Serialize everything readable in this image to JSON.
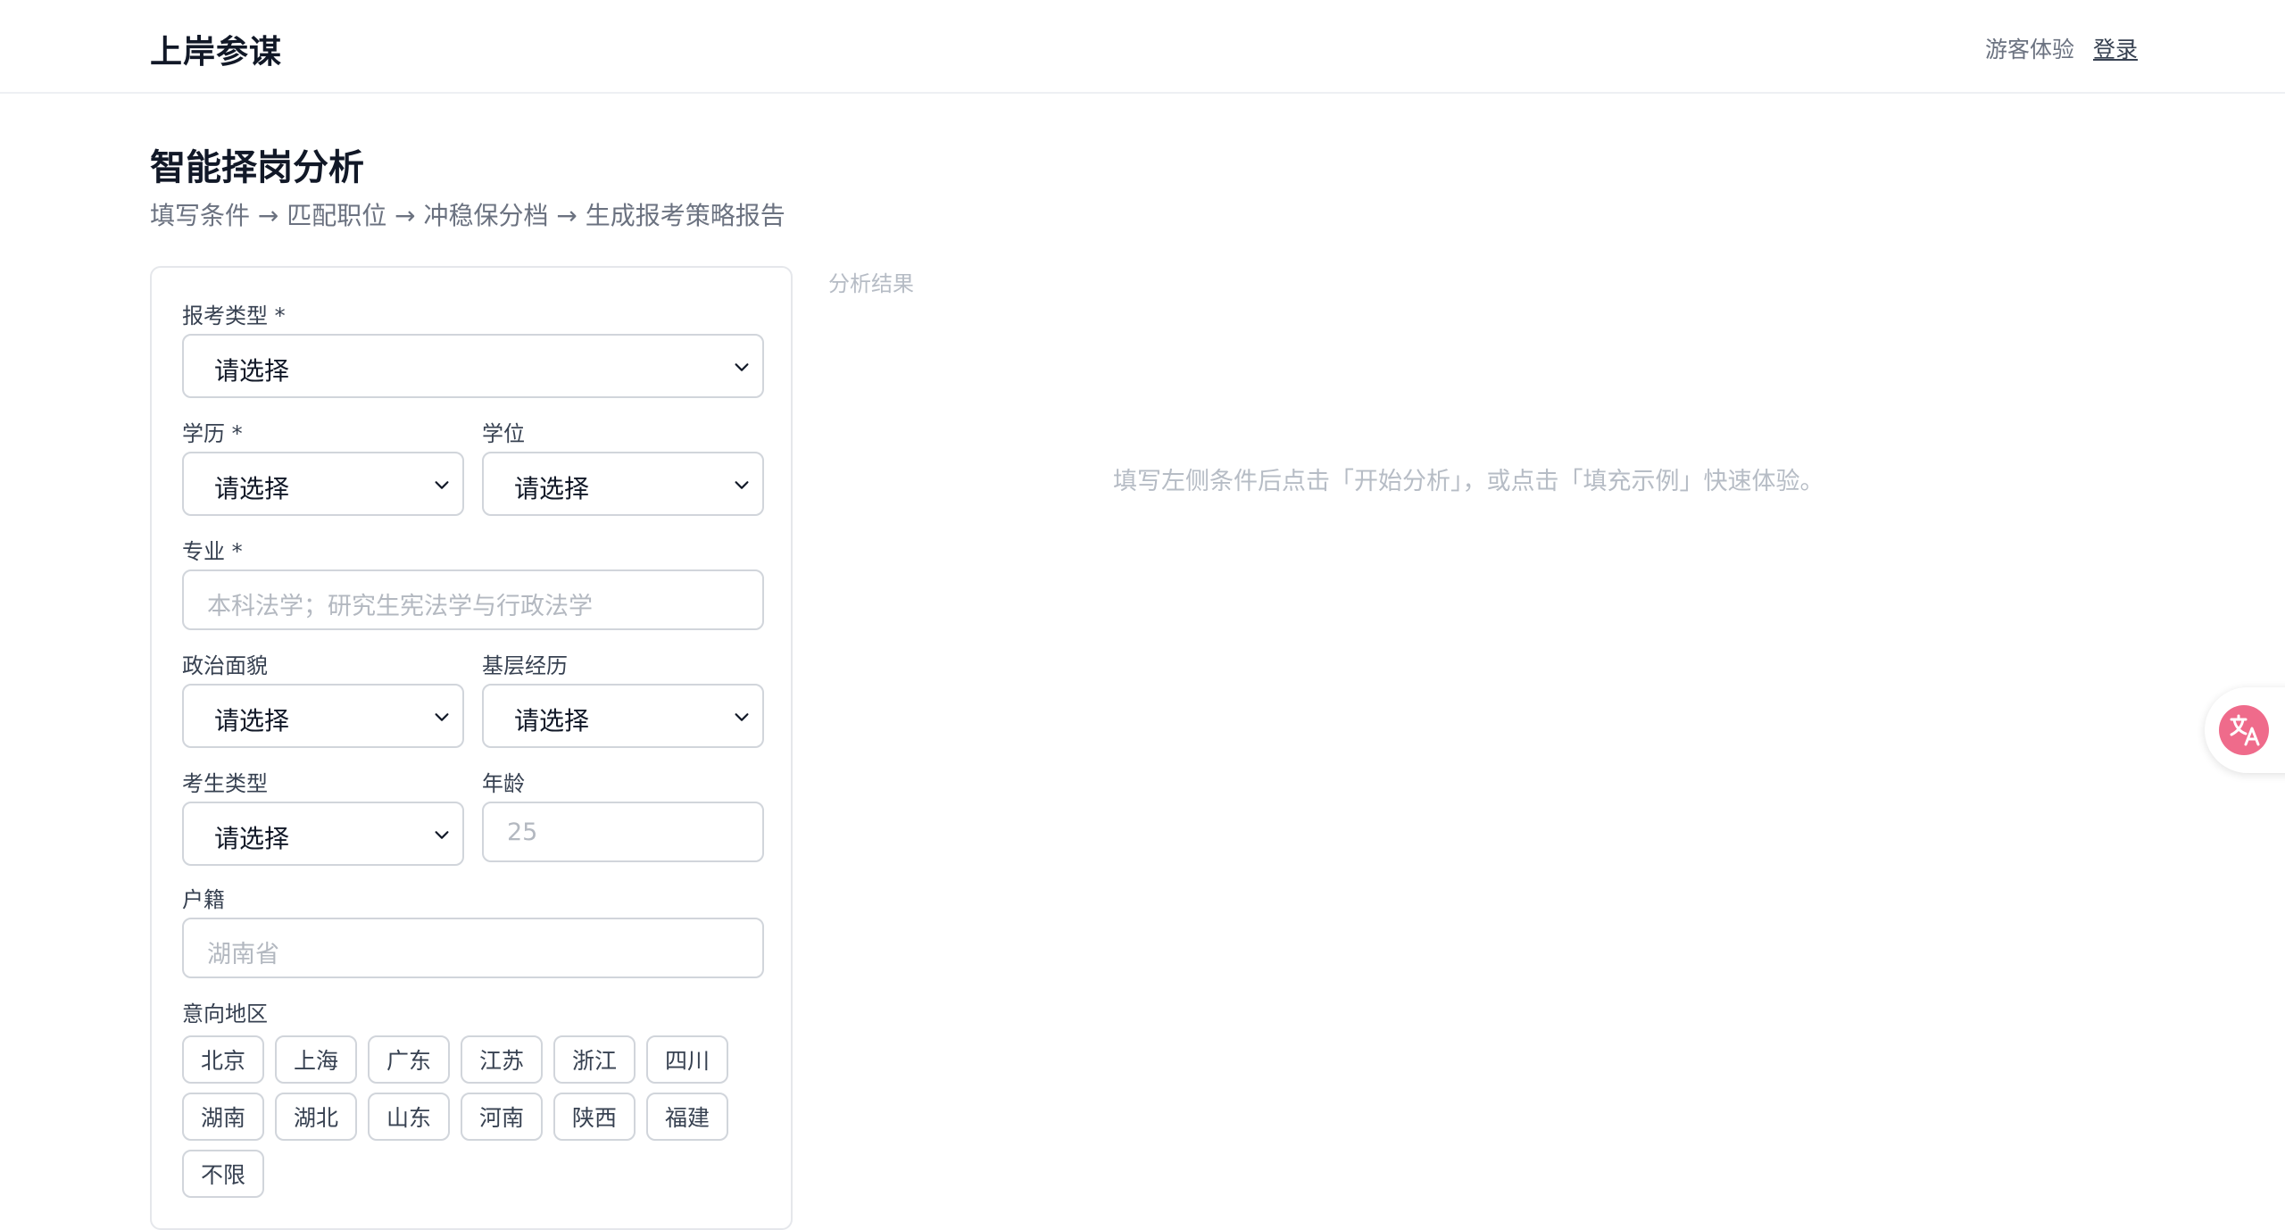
{
  "header": {
    "brand": "上岸参谋",
    "guest_link": "游客体验",
    "login_link": "登录"
  },
  "page": {
    "title": "智能择岗分析",
    "subtitle": "填写条件 → 匹配职位 → 冲稳保分档 → 生成报考策略报告"
  },
  "form": {
    "exam_type": {
      "label": "报考类型 *",
      "value": "请选择"
    },
    "education": {
      "label": "学历 *",
      "value": "请选择"
    },
    "degree": {
      "label": "学位",
      "value": "请选择"
    },
    "major": {
      "label": "专业 *",
      "placeholder": "本科法学；研究生宪法学与行政法学"
    },
    "political_status": {
      "label": "政治面貌",
      "value": "请选择"
    },
    "grassroots_experience": {
      "label": "基层经历",
      "value": "请选择"
    },
    "candidate_type": {
      "label": "考生类型",
      "value": "请选择"
    },
    "age": {
      "label": "年龄",
      "placeholder": "25"
    },
    "household": {
      "label": "户籍",
      "placeholder": "湖南省"
    },
    "regions": {
      "label": "意向地区",
      "options": [
        "北京",
        "上海",
        "广东",
        "江苏",
        "浙江",
        "四川",
        "湖南",
        "湖北",
        "山东",
        "河南",
        "陕西",
        "福建",
        "不限"
      ]
    }
  },
  "result": {
    "label": "分析结果",
    "empty_text": "填写左侧条件后点击「开始分析」，或点击「填充示例」快速体验。"
  },
  "icons": {
    "chevron": "chevron-down-icon",
    "translate": "translate-icon"
  },
  "colors": {
    "accent_translate": "#ef6b8b",
    "border": "#d1d5db",
    "muted_text": "#b6bcc5"
  }
}
